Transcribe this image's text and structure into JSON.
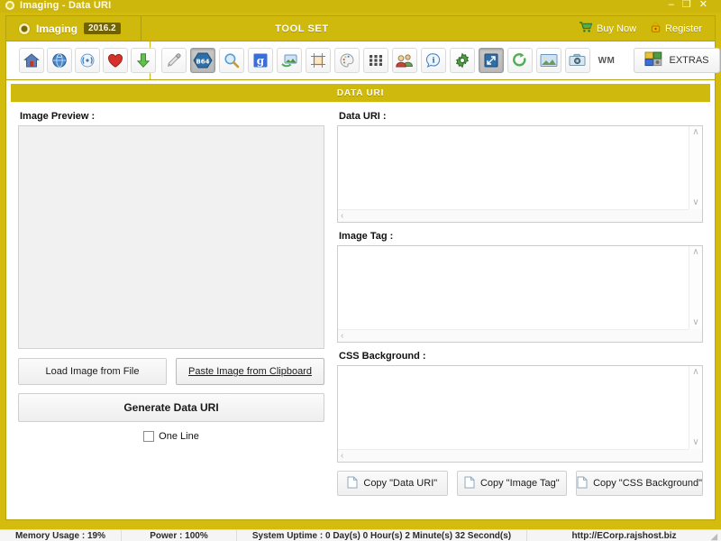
{
  "window": {
    "title": "Imaging -  Data URI",
    "controls": {
      "minimize": "–",
      "maximize": "❐",
      "close": "✕"
    }
  },
  "header": {
    "brand_name": "Imaging",
    "version": "2016.2",
    "toolset_label": "TOOL SET",
    "buy_now": "Buy Now",
    "register": "Register",
    "accent_color": "#cfb90d",
    "frame_color": "#d4bc0e"
  },
  "toolbar": {
    "left_icons": [
      {
        "name": "home-icon"
      },
      {
        "name": "info-globe-icon"
      },
      {
        "name": "rss-signal-icon"
      },
      {
        "name": "heart-icon"
      },
      {
        "name": "download-arrow-icon"
      }
    ],
    "main_icons": [
      {
        "name": "eyedropper-icon",
        "pressed": false
      },
      {
        "name": "base64-icon",
        "label": "B64",
        "pressed": true
      },
      {
        "name": "magnifier-icon",
        "pressed": false
      },
      {
        "name": "google-icon",
        "label": "g",
        "pressed": false
      },
      {
        "name": "image-convert-icon",
        "pressed": false
      },
      {
        "name": "crop-icon",
        "pressed": false
      },
      {
        "name": "palette-icon",
        "pressed": false
      },
      {
        "name": "grid-icon",
        "pressed": false
      },
      {
        "name": "users-icon",
        "pressed": false
      },
      {
        "name": "info-bubble-icon",
        "pressed": false
      },
      {
        "name": "gear-icon",
        "pressed": false
      },
      {
        "name": "resize-icon",
        "pressed": true
      },
      {
        "name": "rotate-icon",
        "pressed": false
      },
      {
        "name": "landscape-image-icon",
        "pressed": false
      },
      {
        "name": "camera-icon",
        "pressed": false
      },
      {
        "name": "watermark-icon",
        "label": "WM",
        "pressed": false
      }
    ],
    "extras_label": "EXTRAS"
  },
  "main": {
    "banner_title": "DATA URI",
    "left": {
      "preview_label": "Image Preview :",
      "load_button": "Load Image from File",
      "paste_button": "Paste Image from Clipboard",
      "generate_button": "Generate Data URI",
      "one_line_label": "One Line",
      "one_line_checked": false
    },
    "right": {
      "data_uri_label": "Data URI :",
      "data_uri_value": "",
      "image_tag_label": "Image Tag :",
      "image_tag_value": "",
      "css_background_label": "CSS Background :",
      "css_background_value": "",
      "copy_data_uri": "Copy \"Data URI\"",
      "copy_image_tag": "Copy \"Image Tag\"",
      "copy_css_background": "Copy \"CSS Background\""
    },
    "scroll": {
      "up": "∧",
      "down": "∨",
      "left": "‹",
      "right": "›"
    }
  },
  "statusbar": {
    "memory": "Memory Usage : 19%",
    "power": "Power : 100%",
    "uptime": "System Uptime : 0 Day(s) 0 Hour(s) 2 Minute(s) 32 Second(s)",
    "url": "http://ECorp.rajshost.biz"
  }
}
